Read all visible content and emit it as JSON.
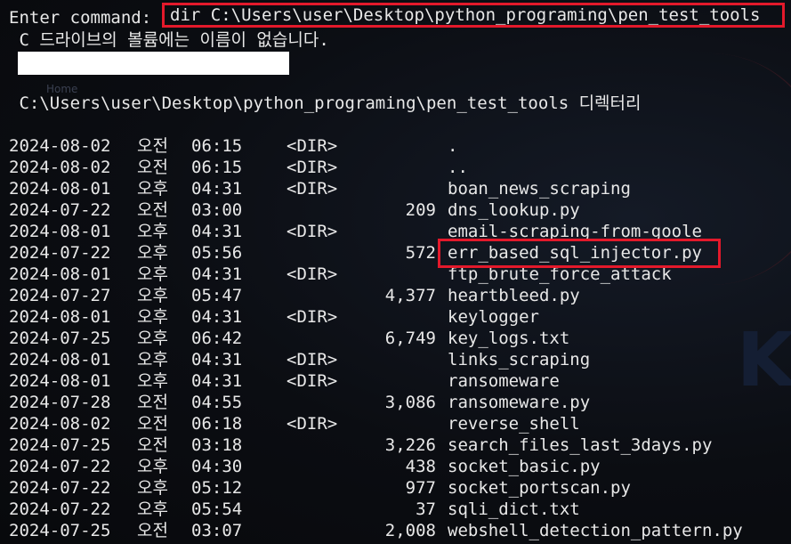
{
  "prompt": "Enter command:",
  "command": "dir C:\\Users\\user\\Desktop\\python_programing\\pen_test_tools",
  "volume_label": " C 드라이브의 볼륨에는 이름이 없습니다.",
  "background_text": "Home",
  "directory_header": " C:\\Users\\user\\Desktop\\python_programing\\pen_test_tools 디렉터리",
  "entries": [
    {
      "date": "2024-08-02",
      "ampm": "오전",
      "time": "06:15",
      "dir": "<DIR>",
      "size": "",
      "name": "."
    },
    {
      "date": "2024-08-02",
      "ampm": "오전",
      "time": "06:15",
      "dir": "<DIR>",
      "size": "",
      "name": ".."
    },
    {
      "date": "2024-08-01",
      "ampm": "오후",
      "time": "04:31",
      "dir": "<DIR>",
      "size": "",
      "name": "boan_news_scraping"
    },
    {
      "date": "2024-07-22",
      "ampm": "오전",
      "time": "03:00",
      "dir": "",
      "size": "209",
      "name": "dns_lookup.py"
    },
    {
      "date": "2024-08-01",
      "ampm": "오후",
      "time": "04:31",
      "dir": "<DIR>",
      "size": "",
      "name": "email-scraping-from-goole"
    },
    {
      "date": "2024-07-22",
      "ampm": "오후",
      "time": "05:56",
      "dir": "",
      "size": "572",
      "name": "err_based_sql_injector.py"
    },
    {
      "date": "2024-08-01",
      "ampm": "오후",
      "time": "04:31",
      "dir": "<DIR>",
      "size": "",
      "name": "ftp_brute_force_attack"
    },
    {
      "date": "2024-07-27",
      "ampm": "오후",
      "time": "05:47",
      "dir": "",
      "size": "4,377",
      "name": "heartbleed.py"
    },
    {
      "date": "2024-08-01",
      "ampm": "오후",
      "time": "04:31",
      "dir": "<DIR>",
      "size": "",
      "name": "keylogger"
    },
    {
      "date": "2024-07-25",
      "ampm": "오후",
      "time": "06:42",
      "dir": "",
      "size": "6,749",
      "name": "key_logs.txt"
    },
    {
      "date": "2024-08-01",
      "ampm": "오후",
      "time": "04:31",
      "dir": "<DIR>",
      "size": "",
      "name": "links_scraping"
    },
    {
      "date": "2024-08-01",
      "ampm": "오후",
      "time": "04:31",
      "dir": "<DIR>",
      "size": "",
      "name": "ransomeware"
    },
    {
      "date": "2024-07-28",
      "ampm": "오전",
      "time": "04:55",
      "dir": "",
      "size": "3,086",
      "name": "ransomeware.py"
    },
    {
      "date": "2024-08-02",
      "ampm": "오전",
      "time": "06:18",
      "dir": "<DIR>",
      "size": "",
      "name": "reverse_shell"
    },
    {
      "date": "2024-07-25",
      "ampm": "오전",
      "time": "03:18",
      "dir": "",
      "size": "3,226",
      "name": "search_files_last_3days.py"
    },
    {
      "date": "2024-07-22",
      "ampm": "오후",
      "time": "04:30",
      "dir": "",
      "size": "438",
      "name": "socket_basic.py"
    },
    {
      "date": "2024-07-22",
      "ampm": "오후",
      "time": "05:12",
      "dir": "",
      "size": "977",
      "name": "socket_portscan.py"
    },
    {
      "date": "2024-07-22",
      "ampm": "오후",
      "time": "05:54",
      "dir": "",
      "size": "37",
      "name": "sqli_dict.txt"
    },
    {
      "date": "2024-07-25",
      "ampm": "오전",
      "time": "03:07",
      "dir": "",
      "size": "2,008",
      "name": "webshell_detection_pattern.py"
    }
  ],
  "highlight_color": "#e3192b"
}
